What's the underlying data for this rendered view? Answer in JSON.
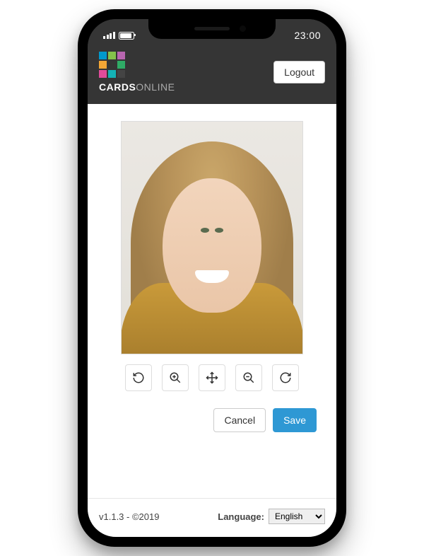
{
  "status_bar": {
    "time": "23:00"
  },
  "header": {
    "brand_bold": "CARDS",
    "brand_light": "ONLINE",
    "logout_label": "Logout",
    "logo_colors": [
      "#0099cc",
      "#84c24b",
      "#b866b0",
      "#f3a635",
      "#444444",
      "#2fab66",
      "#e04b9a",
      "#14b2b5",
      "#444444"
    ]
  },
  "tools": {
    "rotate_left": "rotate-left",
    "zoom_in": "zoom-in",
    "move": "move",
    "zoom_out": "zoom-out",
    "rotate_right": "rotate-right"
  },
  "actions": {
    "cancel_label": "Cancel",
    "save_label": "Save"
  },
  "footer": {
    "version_text": "v1.1.3 - ©2019",
    "language_label": "Language:",
    "language_selected": "English"
  },
  "colors": {
    "primary": "#2e98d4",
    "header_bg": "#353535"
  }
}
